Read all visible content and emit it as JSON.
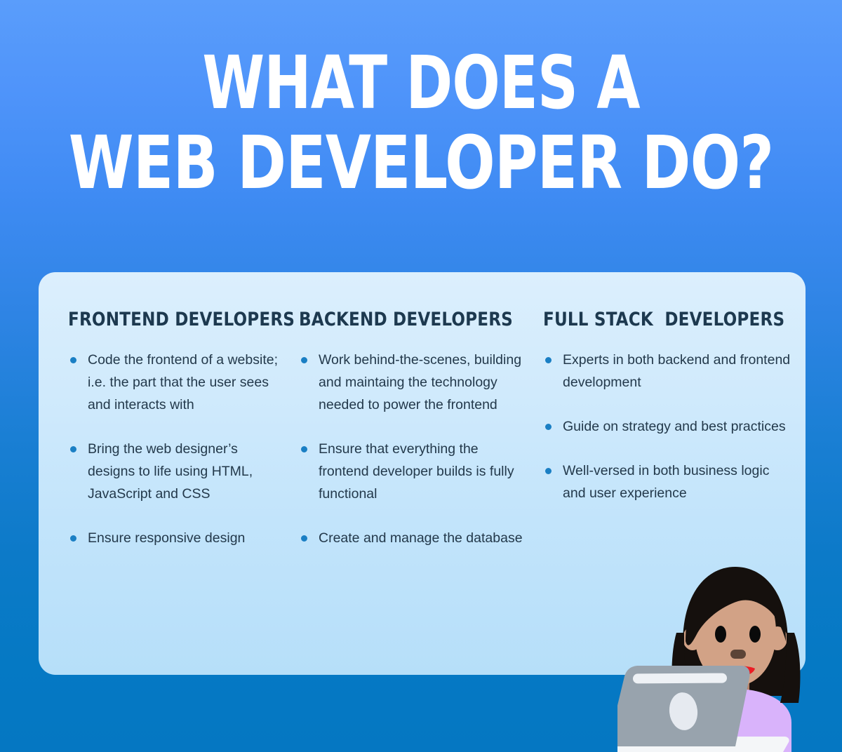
{
  "title": {
    "line1": "WHAT DOES A",
    "line2": "WEB DEVELOPER DO?"
  },
  "colors": {
    "background_top": "#5a9dfb",
    "background_bottom": "#0579c4",
    "card_top": "#dceffd",
    "card_bottom": "#b6dff9",
    "title_text": "#ffffff",
    "header_text": "#1d394f",
    "body_text": "#23394b",
    "bullet": "#1a7fc4"
  },
  "columns": [
    {
      "header": "FRONTEND DEVELOPERS",
      "bullets": [
        "Code the frontend of a website; i.e. the part that the user sees and interacts with",
        "Bring the web designer’s designs to life using HTML, JavaScript and CSS",
        "Ensure responsive design"
      ]
    },
    {
      "header": "BACKEND DEVELOPERS",
      "bullets": [
        "Work behind-the-scenes, building and maintaing the technology needed to power the frontend",
        "Ensure that everything the frontend developer builds is fully functional",
        "Create and manage the database"
      ]
    },
    {
      "header": "FULL STACK  DEVELOPERS",
      "bullets": [
        "Experts in both backend and frontend development",
        "Guide on strategy and best practices",
        "Well-versed in both business logic and user experience"
      ]
    }
  ],
  "illustration": {
    "name": "woman-technologist-illustration",
    "skin": "#d2a286",
    "hair": "#15100d",
    "shirt": "#d9b3fb",
    "laptop_body": "#98a3ad",
    "laptop_base": "#f4f6f8",
    "lips": "#ec1c24",
    "nose": "#5b4437"
  }
}
